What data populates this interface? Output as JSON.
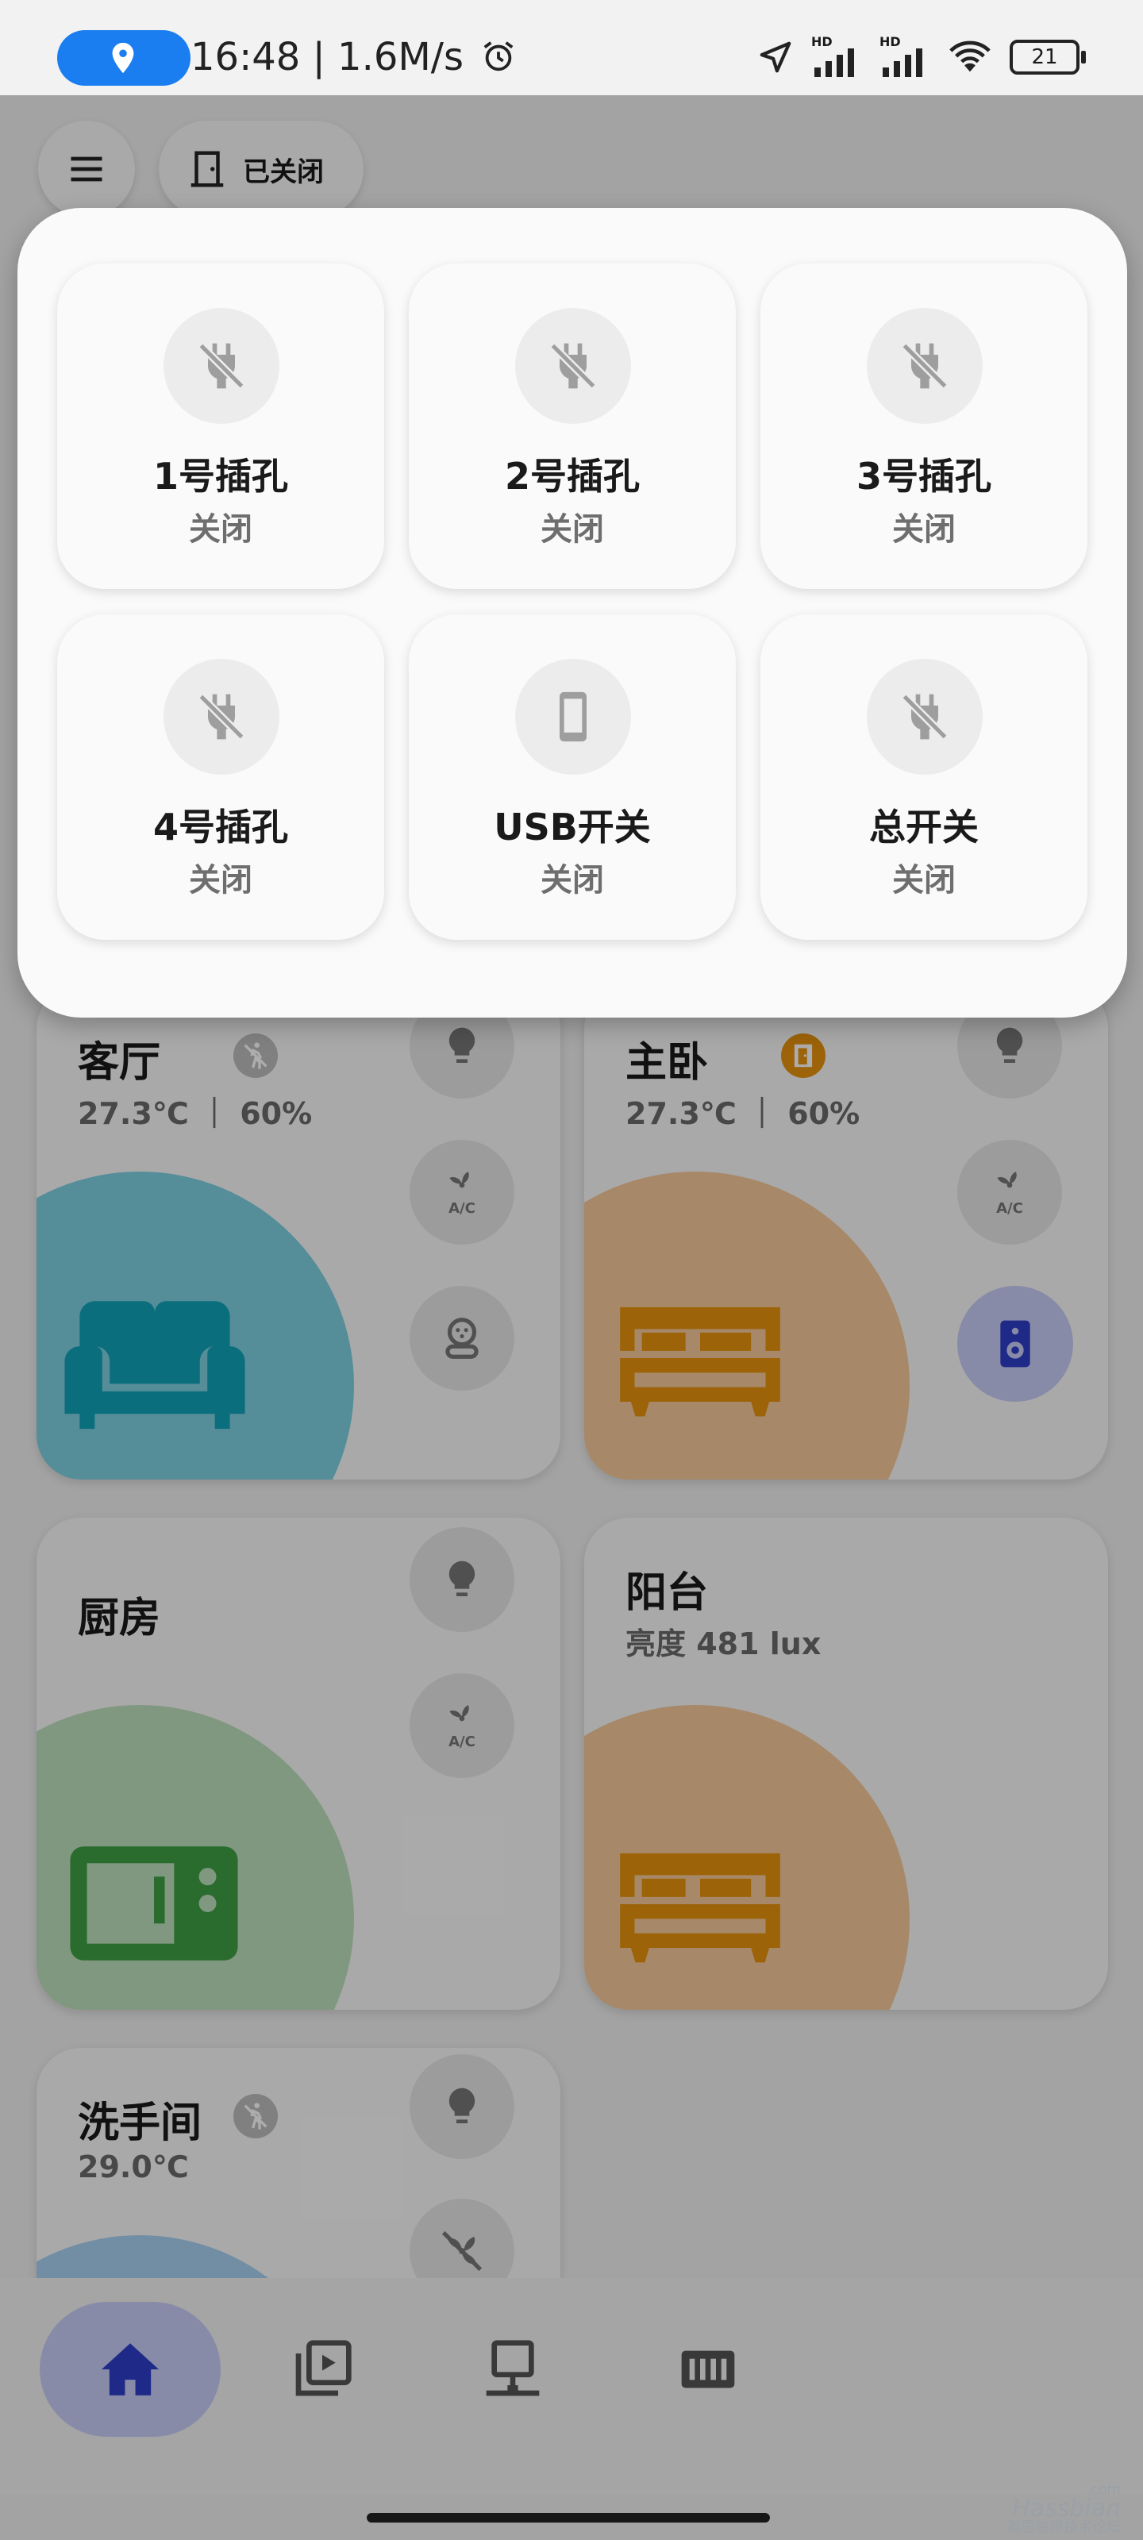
{
  "status_bar": {
    "time": "16:48",
    "speed": "1.6M/s",
    "network_tag": "HD",
    "battery": "21",
    "location_pill_color": "#1a7df0"
  },
  "header": {
    "door_label": "已关闭"
  },
  "rooms": {
    "living": {
      "name": "客厅",
      "sub": "27.3℃ ｜ 60%",
      "blob_color": "#7ed0e2",
      "icon_color": "#11a3b8"
    },
    "master": {
      "name": "主卧",
      "sub": "27.3℃ ｜ 60%",
      "blob_color": "#f7c99a",
      "icon_color": "#e6920e"
    },
    "kitchen": {
      "name": "厨房",
      "blob_color": "#bfe0bd",
      "icon_color": "#3d9f45"
    },
    "balcony": {
      "name": "阳台",
      "sub": "亮度 481 lux",
      "blob_color": "#f7c99a",
      "icon_color": "#e6920e"
    },
    "bathroom": {
      "name": "洗手间",
      "sub": "29.0℃",
      "blob_color": "#a9d2f2"
    }
  },
  "nav": {
    "active_color": "#2e3fc9",
    "active_bg": "#c7cdf8"
  },
  "watermark": {
    "domain_tag": ".com",
    "brand": "Hassbian",
    "subtitle": "瀚思彼岸技术论坛"
  },
  "dialog": {
    "tiles": [
      {
        "name": "1号插孔",
        "state": "关闭",
        "icon": "power-plug-off-icon"
      },
      {
        "name": "2号插孔",
        "state": "关闭",
        "icon": "power-plug-off-icon"
      },
      {
        "name": "3号插孔",
        "state": "关闭",
        "icon": "power-plug-off-icon"
      },
      {
        "name": "4号插孔",
        "state": "关闭",
        "icon": "power-plug-off-icon"
      },
      {
        "name": "USB开关",
        "state": "关闭",
        "icon": "cellphone-icon"
      },
      {
        "name": "总开关",
        "state": "关闭",
        "icon": "power-plug-off-icon"
      }
    ]
  }
}
